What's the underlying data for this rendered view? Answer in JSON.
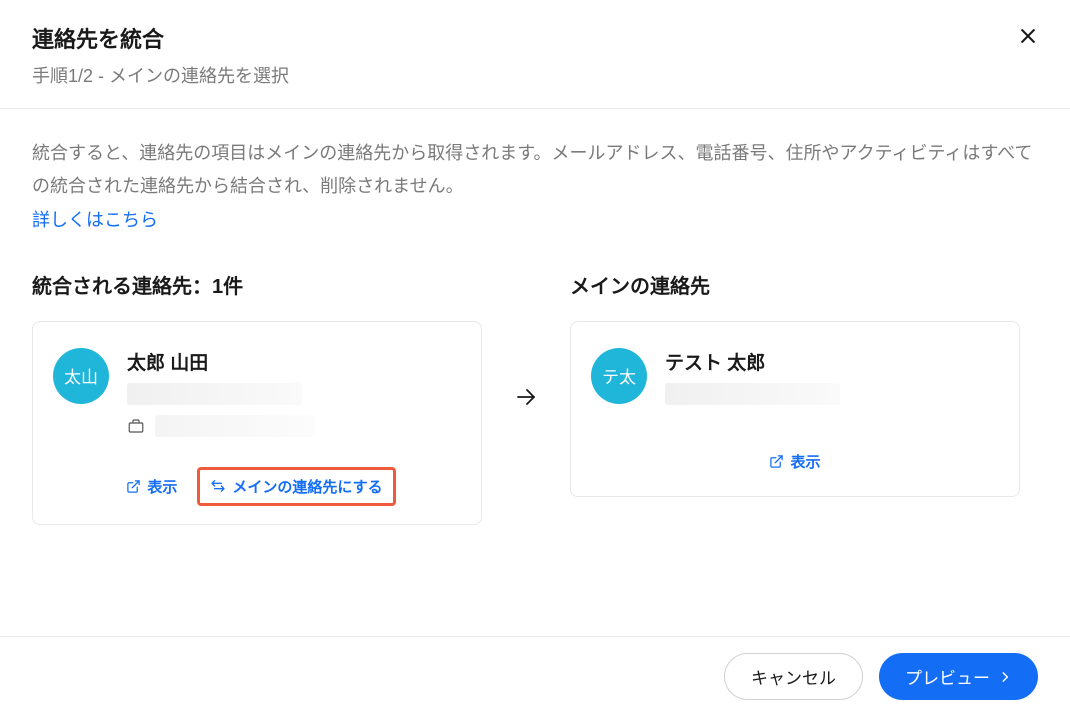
{
  "header": {
    "title": "連絡先を統合",
    "subtitle": "手順1/2 - メインの連絡先を選択"
  },
  "body": {
    "description": "統合すると、連絡先の項目はメインの連絡先から取得されます。メールアドレス、電話番号、住所やアクティビティはすべての統合された連絡先から結合され、削除されません。",
    "learn_more": "詳しくはこちら"
  },
  "columns": {
    "left_title": "統合される連絡先：1件",
    "right_title": "メインの連絡先"
  },
  "contacts": {
    "merged": {
      "avatar_text": "太山",
      "name": "太郎 山田",
      "view_label": "表示",
      "make_primary_label": "メインの連絡先にする"
    },
    "primary": {
      "avatar_text": "テ太",
      "name": "テスト 太郎",
      "view_label": "表示"
    }
  },
  "footer": {
    "cancel": "キャンセル",
    "preview": "プレビュー"
  }
}
